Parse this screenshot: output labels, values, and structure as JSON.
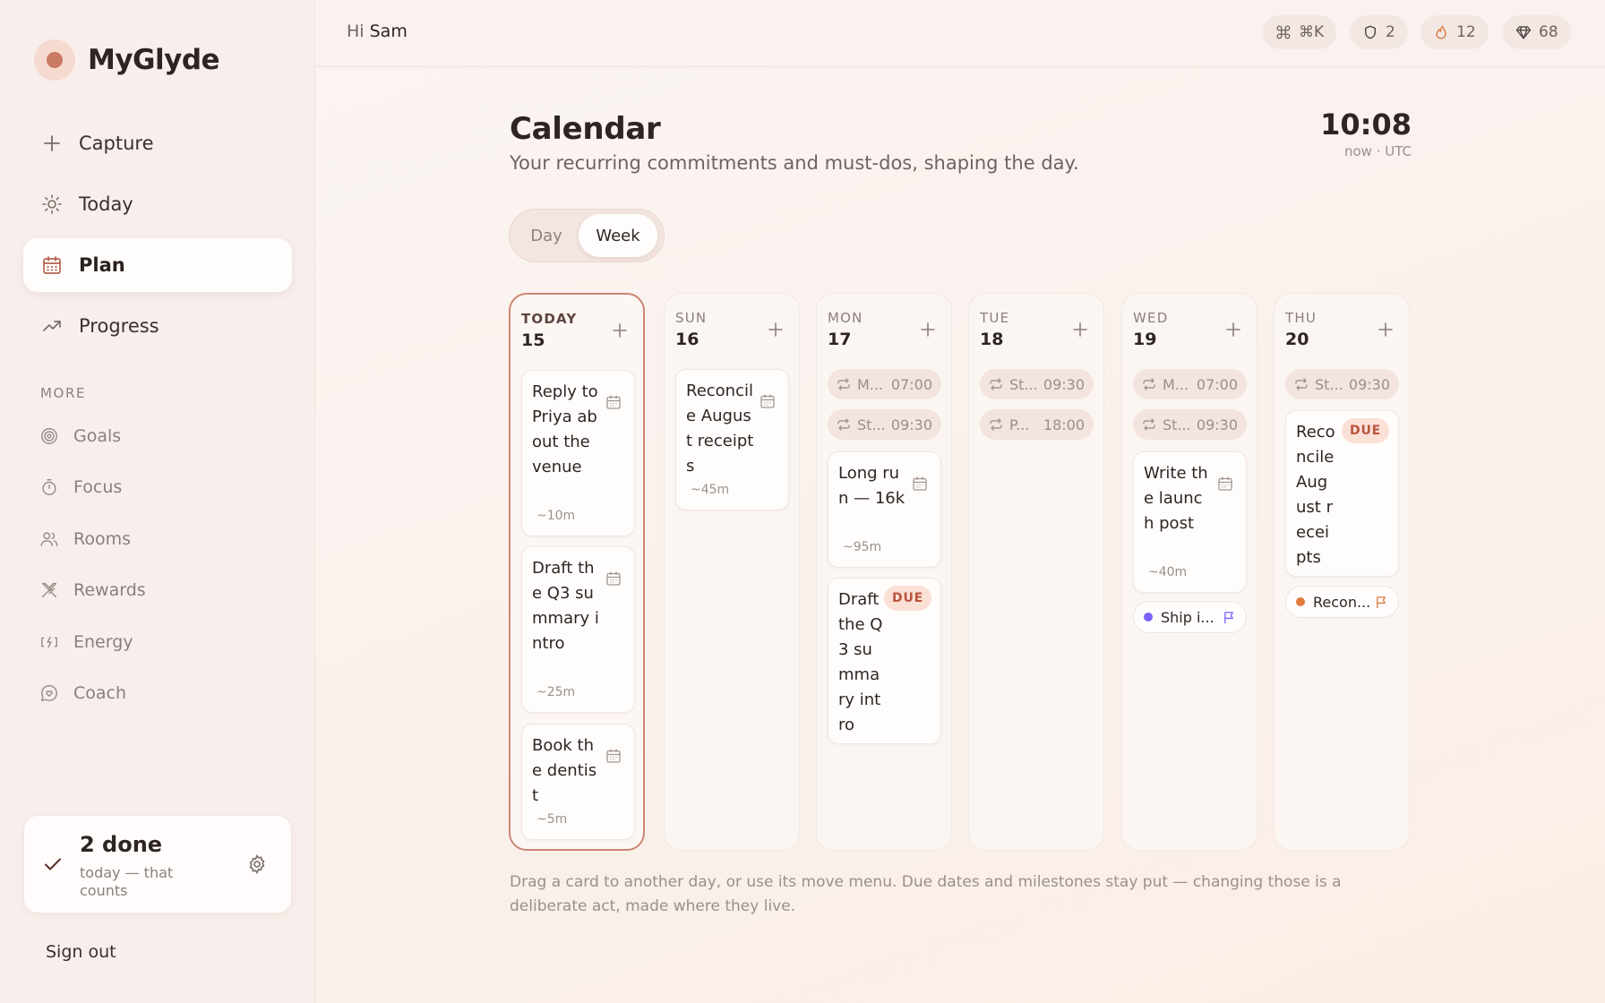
{
  "brand": {
    "name": "MyGlyde",
    "accent": "#c97a62"
  },
  "nav": {
    "items": [
      {
        "label": "Capture",
        "icon": "plus-icon"
      },
      {
        "label": "Today",
        "icon": "sun-icon"
      },
      {
        "label": "Plan",
        "icon": "calendar-icon",
        "active": true
      },
      {
        "label": "Progress",
        "icon": "trend-up-icon"
      }
    ],
    "more_label": "MORE",
    "more_items": [
      {
        "label": "Goals",
        "icon": "target-icon"
      },
      {
        "label": "Focus",
        "icon": "timer-icon"
      },
      {
        "label": "Rooms",
        "icon": "people-icon"
      },
      {
        "label": "Rewards",
        "icon": "swords-icon"
      },
      {
        "label": "Energy",
        "icon": "battery-icon"
      },
      {
        "label": "Coach",
        "icon": "chat-heart-icon"
      }
    ]
  },
  "done_card": {
    "title": "2 done",
    "subtitle": "today — that counts"
  },
  "signout": "Sign out",
  "topbar": {
    "greeting": "Hi",
    "user": "Sam",
    "command": "⌘K",
    "shields": "2",
    "streak": "12",
    "gems": "68"
  },
  "page": {
    "title": "Calendar",
    "subtitle": "Your recurring commitments and must-dos, shaping the day.",
    "time": "10:08",
    "time_label": "now · UTC"
  },
  "view_toggle": {
    "day": "Day",
    "week": "Week",
    "selected": "Week"
  },
  "week": {
    "today": {
      "dow": "TODAY",
      "date": "15"
    },
    "sun": {
      "dow": "SUN",
      "date": "16"
    },
    "mon": {
      "dow": "MON",
      "date": "17"
    },
    "tue": {
      "dow": "TUE",
      "date": "18"
    },
    "wed": {
      "dow": "WED",
      "date": "19"
    },
    "thu": {
      "dow": "THU",
      "date": "20"
    }
  },
  "cards": {
    "t1": {
      "title": "Reply to Priya about the venue",
      "est": "~10m"
    },
    "t2": {
      "title": "Draft the Q3 summary intro",
      "est": "~25m"
    },
    "t3": {
      "title": "Book the dentist",
      "est": "~5m"
    },
    "s1": {
      "title": "Reconcile August receipts",
      "est": "~45m"
    },
    "m1": {
      "title": "Long run — 16k",
      "est": "~95m"
    },
    "m2": {
      "title": "Draft the Q3 summary intro",
      "due": "DUE"
    },
    "w1": {
      "title": "Write the launch post",
      "est": "~40m"
    },
    "h1": {
      "title": "Reconcile August receipts",
      "due": "DUE"
    }
  },
  "recurring": {
    "m_r1": {
      "label": "M...",
      "time": "07:00"
    },
    "m_r2": {
      "label": "St...",
      "time": "09:30"
    },
    "tu_r1": {
      "label": "St...",
      "time": "09:30"
    },
    "tu_r2": {
      "label": "P...",
      "time": "18:00"
    },
    "w_r1": {
      "label": "M...",
      "time": "07:00"
    },
    "w_r2": {
      "label": "St...",
      "time": "09:30"
    },
    "h_r1": {
      "label": "St...",
      "time": "09:30"
    }
  },
  "milestones": {
    "w_ms": {
      "label": "Ship i...",
      "color": "#7b61ff"
    },
    "h_ms": {
      "label": "Recon...",
      "color": "#e07b3c"
    }
  },
  "footnote": "Drag a card to another day, or use its move menu. Due dates and milestones stay put — changing those is a deliberate act, made where they live."
}
